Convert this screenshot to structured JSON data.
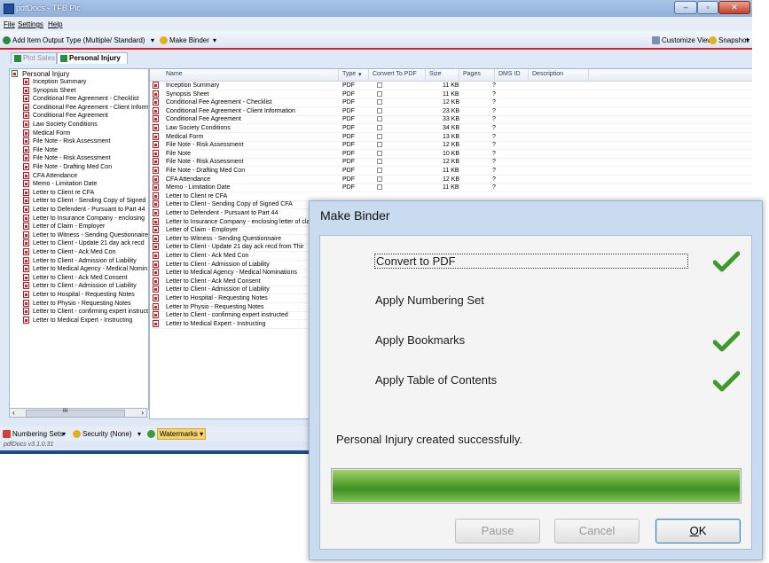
{
  "window": {
    "title": "pdfDocs - TFB Plc",
    "min": "–",
    "max": "▫",
    "close": "✕"
  },
  "menu": {
    "file": "File",
    "settings": "Settings",
    "help": "Help"
  },
  "toolbar": {
    "add_item": "Add Item",
    "output_type": "Output Type (Multiple/ Standard)",
    "output_arrow": "▾",
    "make_binder": "Make Binder",
    "make_binder_arrow": "▾",
    "customize_view": "Customize View",
    "snapshot": "Snapshot",
    "snapshot_arrow": "▾"
  },
  "tabs": [
    {
      "label": "Plot Sales",
      "active": false
    },
    {
      "label": "Personal Injury",
      "active": true
    }
  ],
  "tree": {
    "root": "Personal Injury",
    "items": [
      "Inception Summary",
      "Synopsis Sheet",
      "Conditional Fee Agreement - Checklist",
      "Conditional Fee Agreement - Client Inform",
      "Conditional Fee Agreement",
      "Law Society Conditions",
      "Medical Form",
      "File Note - Risk Assessment",
      "File Note",
      "File Note - Risk Assessment",
      "File Note - Drafting Med Con",
      "CFA Attendance",
      "Memo - Limitation Date",
      "Letter  to Client re CFA",
      "Letter to Client - Sending Copy of Signed",
      "Letter to Defendent - Pursuant to Part 44",
      "Letter to Insurance Company - enclosing",
      "Letter of Claim - Employer",
      "Letter to Witness - Sending Questionnaire",
      "Letter to Client - Update 21 day ack recd",
      "Letter to Client - Ack Med Con",
      "Letter to Client - Admission of Liability",
      "Letter to Medical Agency - Medical Nomin",
      "Letter to Client - Ack Med Consent",
      "Letter to Client - Admission of Liability",
      "Letter to Hospital - Requesting Notes",
      "Letter to Physio - Requesting Notes",
      "Letter to Client - confirming expert instruct",
      "Letter to Medical Expert - Instructing"
    ],
    "scroll_left": "‹",
    "scroll_right": "›",
    "scroll_grip": "III"
  },
  "grid": {
    "columns": {
      "name": "Name",
      "type": "Type",
      "sort_arrow": "▾",
      "convert": "Convert To PDF",
      "size": "Size",
      "pages": "Pages",
      "dms": "DMS ID",
      "desc": "Description"
    },
    "rows": [
      {
        "name": "Inception Summary",
        "type": "PDF",
        "size": "11 KB",
        "pages": "?"
      },
      {
        "name": "Synopsis Sheet",
        "type": "PDF",
        "size": "11 KB",
        "pages": "?"
      },
      {
        "name": "Conditional Fee Agreement - Checklist",
        "type": "PDF",
        "size": "12 KB",
        "pages": "?"
      },
      {
        "name": "Conditional Fee Agreement - Client Information",
        "type": "PDF",
        "size": "23 KB",
        "pages": "?"
      },
      {
        "name": "Conditional Fee Agreement",
        "type": "PDF",
        "size": "33 KB",
        "pages": "?"
      },
      {
        "name": "Law Society Conditions",
        "type": "PDF",
        "size": "34 KB",
        "pages": "?"
      },
      {
        "name": "Medical Form",
        "type": "PDF",
        "size": "13 KB",
        "pages": "?"
      },
      {
        "name": "File Note - Risk Assessment",
        "type": "PDF",
        "size": "12 KB",
        "pages": "?"
      },
      {
        "name": "File Note",
        "type": "PDF",
        "size": "10 KB",
        "pages": "?"
      },
      {
        "name": "File Note - Risk Assessment",
        "type": "PDF",
        "size": "12 KB",
        "pages": "?"
      },
      {
        "name": "File Note - Drafting Med Con",
        "type": "PDF",
        "size": "11 KB",
        "pages": "?"
      },
      {
        "name": "CFA Attendance",
        "type": "PDF",
        "size": "12 KB",
        "pages": "?"
      },
      {
        "name": "Memo - Limitation Date",
        "type": "PDF",
        "size": "11 KB",
        "pages": "?"
      },
      {
        "name": "Letter  to Client re CFA",
        "type": "",
        "size": "",
        "pages": ""
      },
      {
        "name": "Letter to Client - Sending Copy of Signed CFA",
        "type": "",
        "size": "",
        "pages": ""
      },
      {
        "name": "Letter to Defendent - Pursuant to Part 44",
        "type": "",
        "size": "",
        "pages": ""
      },
      {
        "name": "Letter to Insurance Company - enclosing letter of cla",
        "type": "",
        "size": "",
        "pages": ""
      },
      {
        "name": "Letter of Claim - Employer",
        "type": "",
        "size": "",
        "pages": ""
      },
      {
        "name": "Letter to Witness - Sending Questionnaire",
        "type": "",
        "size": "",
        "pages": ""
      },
      {
        "name": "Letter to Client - Update 21 day ack recd from Thir",
        "type": "",
        "size": "",
        "pages": ""
      },
      {
        "name": "Letter to Client - Ack Med Con",
        "type": "",
        "size": "",
        "pages": ""
      },
      {
        "name": "Letter to Client - Admission of Liability",
        "type": "",
        "size": "",
        "pages": ""
      },
      {
        "name": "Letter to Medical Agency - Medical Nominations",
        "type": "",
        "size": "",
        "pages": ""
      },
      {
        "name": "Letter to Client - Ack Med Consent",
        "type": "",
        "size": "",
        "pages": ""
      },
      {
        "name": "Letter to Client - Admission of Liability",
        "type": "",
        "size": "",
        "pages": ""
      },
      {
        "name": "Letter to Hospital - Requesting Notes",
        "type": "",
        "size": "",
        "pages": ""
      },
      {
        "name": "Letter to Physio - Requesting Notes",
        "type": "",
        "size": "",
        "pages": ""
      },
      {
        "name": "Letter to Client - confirming expert instructed",
        "type": "",
        "size": "",
        "pages": ""
      },
      {
        "name": "Letter to Medical Expert - Instructing",
        "type": "",
        "size": "",
        "pages": ""
      }
    ]
  },
  "bottombar": {
    "numbering_sets": "Numbering Sets",
    "numbering_arrow": "▾",
    "security": "Security (None)",
    "security_arrow": "▾",
    "watermarks": "Watermarks",
    "watermarks_arrow": "▾"
  },
  "status": {
    "version": "pdfDocs v3.1.0.31"
  },
  "dialog": {
    "title": "Make Binder",
    "steps": [
      {
        "label": "Convert to PDF",
        "done": true
      },
      {
        "label": "Apply Numbering Set",
        "done": false
      },
      {
        "label": "Apply Bookmarks",
        "done": true
      },
      {
        "label": "Apply Table of Contents",
        "done": true
      }
    ],
    "message": "Personal Injury created successfully.",
    "progress": 1.0,
    "buttons": {
      "pause": "Pause",
      "cancel": "Cancel",
      "ok_underline": "O",
      "ok_rest": "K"
    }
  },
  "colors": {
    "accent_red": "#d8202c",
    "check_green": "#3e9a2b",
    "progress_green": "#5fa636"
  }
}
